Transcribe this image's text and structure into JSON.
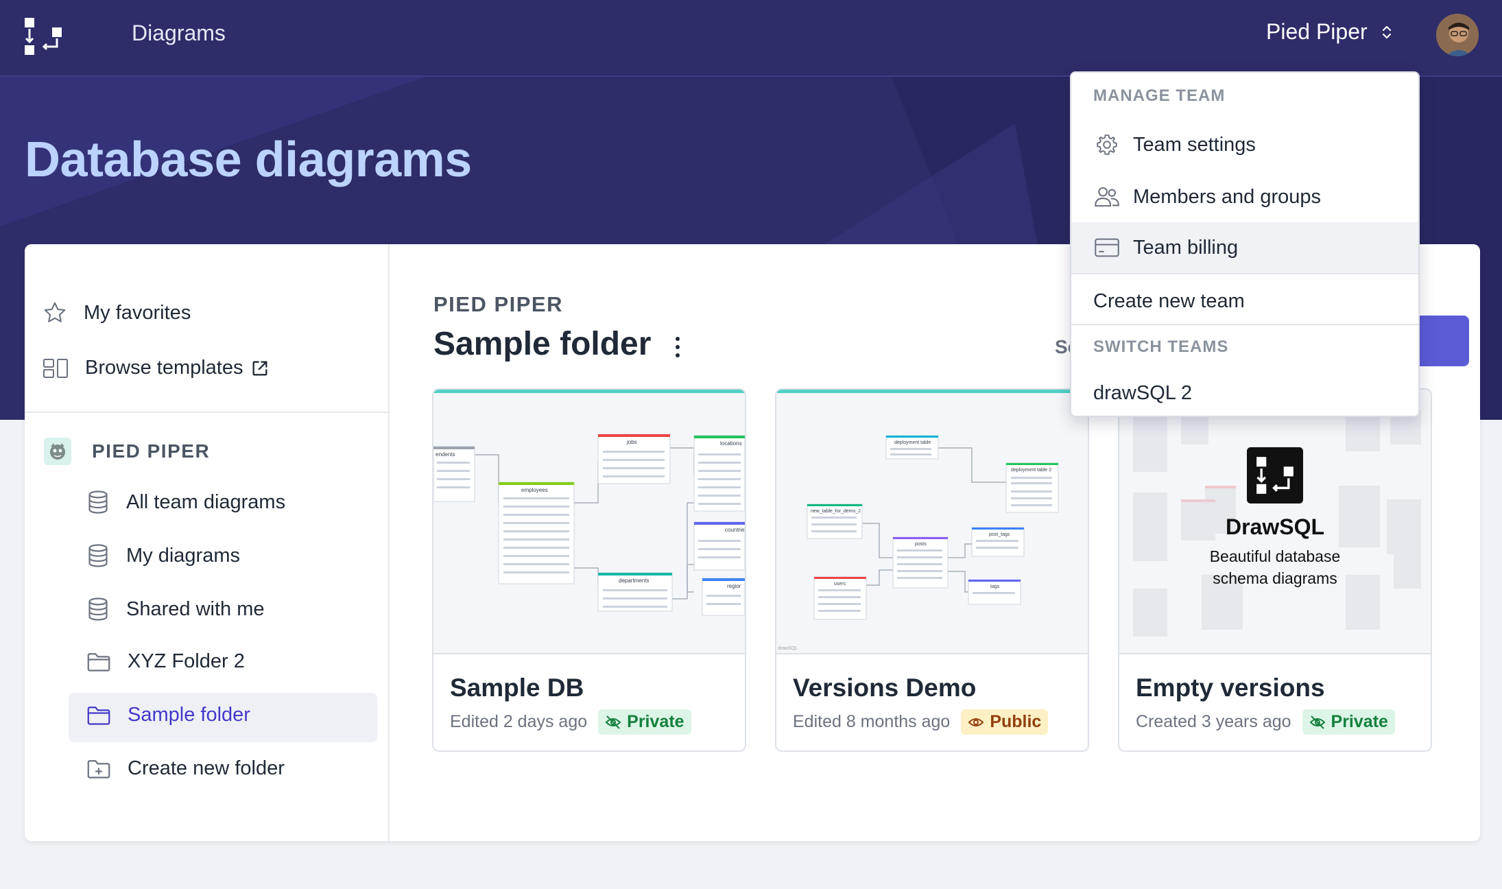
{
  "header": {
    "app_title": "Diagrams",
    "team_name": "Pied Piper"
  },
  "page": {
    "heading": "Database diagrams"
  },
  "sidebar": {
    "favorites": "My favorites",
    "templates": "Browse templates",
    "team_label": "PIED PIPER",
    "items": [
      {
        "label": "All team diagrams",
        "icon": "database-icon"
      },
      {
        "label": "My diagrams",
        "icon": "database-icon"
      },
      {
        "label": "Shared with me",
        "icon": "database-icon"
      },
      {
        "label": "XYZ Folder 2",
        "icon": "folder-icon"
      },
      {
        "label": "Sample folder",
        "icon": "folder-icon",
        "active": true
      },
      {
        "label": "Create new folder",
        "icon": "folder-plus-icon"
      }
    ]
  },
  "content": {
    "breadcrumb": "PIED PIPER",
    "folder_title": "Sample folder",
    "sort_label": "Sort"
  },
  "cards": [
    {
      "name": "Sample DB",
      "meta": "Edited 2 days ago",
      "badge": "Private"
    },
    {
      "name": "Versions Demo",
      "meta": "Edited 8 months ago",
      "badge": "Public"
    },
    {
      "name": "Empty versions",
      "meta": "Created 3 years ago",
      "badge": "Private",
      "promo_title": "DrawSQL",
      "promo_line1": "Beautiful database",
      "promo_line2": "schema diagrams"
    }
  ],
  "thumb_text": {
    "t1": [
      "endents",
      "employees",
      "jobs",
      "locations",
      "countrie",
      "departments",
      "regior"
    ],
    "t2": [
      "deployment table",
      "deployment table 2",
      "new_table_for_demo_2",
      "posts",
      "post_tags",
      "users",
      "tags",
      "drawSQL"
    ]
  },
  "dropdown": {
    "manage_header": "MANAGE TEAM",
    "team_settings": "Team settings",
    "members": "Members and groups",
    "billing": "Team billing",
    "create_team": "Create new team",
    "switch_header": "SWITCH TEAMS",
    "other_team": "drawSQL 2"
  },
  "colors": {
    "hero": "#2e2c69",
    "heading": "#bcd3ff",
    "accent": "#5b5bd6",
    "private": "#15803d",
    "public": "#92400e"
  }
}
